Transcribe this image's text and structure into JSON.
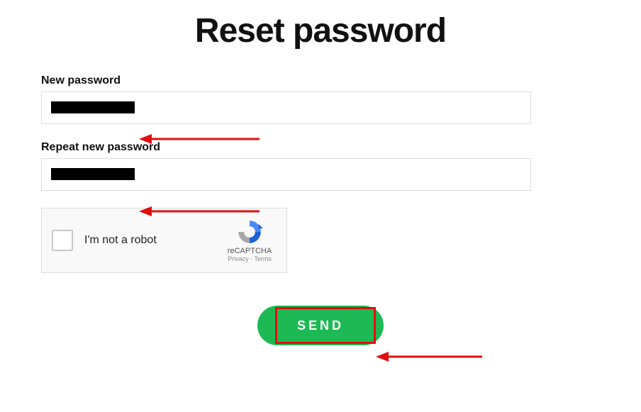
{
  "title": "Reset password",
  "new_password": {
    "label": "New password",
    "value": ""
  },
  "repeat_password": {
    "label": "Repeat new password",
    "value": ""
  },
  "captcha": {
    "not_robot": "I'm not a robot",
    "brand": "reCAPTCHA",
    "privacy": "Privacy",
    "terms": "Terms",
    "sep": " - "
  },
  "send": "SEND",
  "colors": {
    "accent": "#1db954",
    "annotation": "#e40d0d"
  }
}
